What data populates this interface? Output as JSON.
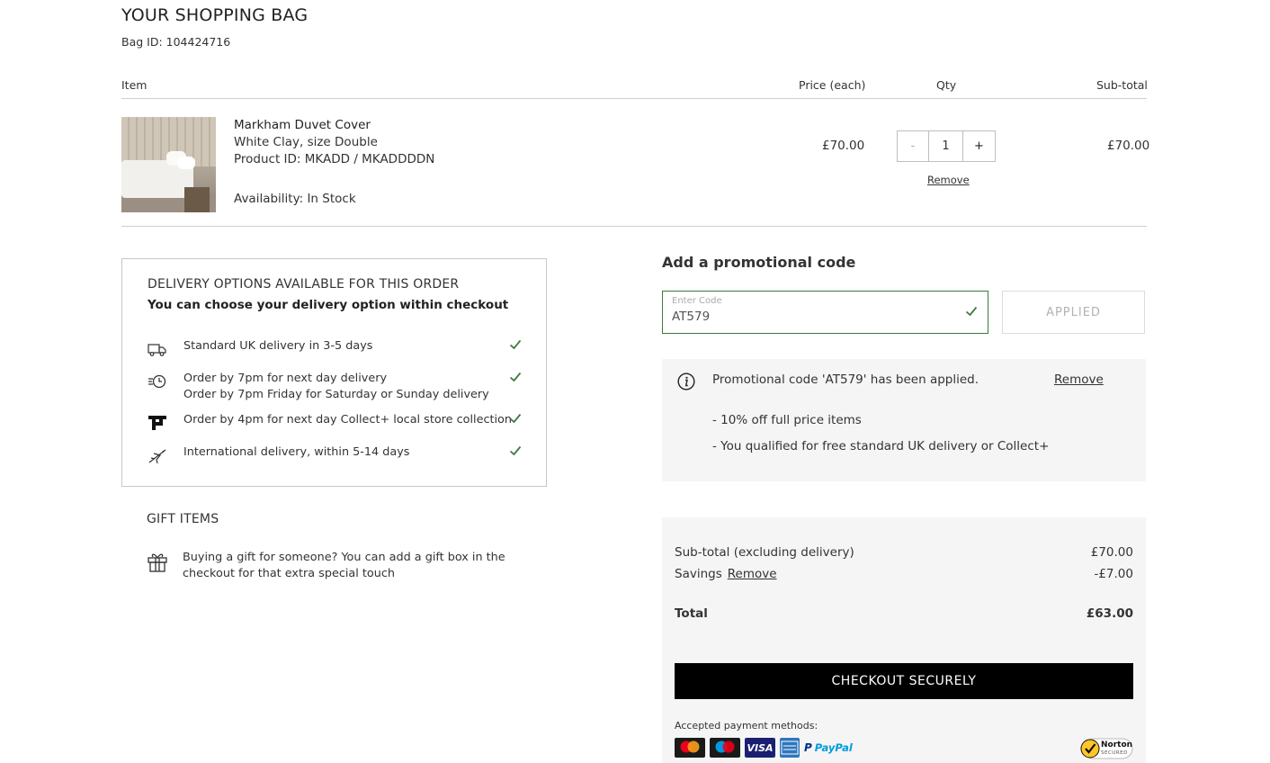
{
  "header": {
    "title": "YOUR SHOPPING BAG",
    "bag_id": "Bag ID: 104424716"
  },
  "columns": {
    "item": "Item",
    "price": "Price (each)",
    "qty": "Qty",
    "subtotal": "Sub-total"
  },
  "item": {
    "name": "Markham Duvet Cover",
    "variant": "White Clay, size Double",
    "product_id": "Product ID: MKADD / MKADDDDN",
    "availability_label": "Availability:",
    "availability_value": "In Stock",
    "price": "£70.00",
    "qty_minus": "-",
    "qty": "1",
    "qty_plus": "+",
    "remove": "Remove",
    "subtotal": "£70.00"
  },
  "delivery": {
    "title": "DELIVERY OPTIONS AVAILABLE FOR THIS ORDER",
    "subtitle": "You can choose your delivery option within checkout",
    "options": [
      {
        "icon": "truck-icon",
        "lines": [
          "Standard UK delivery in 3-5 days"
        ]
      },
      {
        "icon": "next-day-clock-icon",
        "lines": [
          "Order by 7pm for next day delivery",
          "Order by 7pm Friday for Saturday or Sunday delivery"
        ]
      },
      {
        "icon": "collect-plus-icon",
        "lines": [
          "Order by 4pm for next day Collect+ local store collection"
        ]
      },
      {
        "icon": "plane-icon",
        "lines": [
          "International delivery, within 5-14 days"
        ]
      }
    ],
    "check_color": "#3c7a3c"
  },
  "gift": {
    "title": "GIFT ITEMS",
    "text": "Buying a gift for someone? You can add a gift box in the checkout for that extra special touch"
  },
  "promo": {
    "heading": "Add a promotional code",
    "placeholder": "Enter Code",
    "value": "AT579",
    "button": "APPLIED",
    "applied_message": "Promotional code 'AT579' has been applied.",
    "remove": "Remove",
    "benefits": [
      "- 10% off full price items",
      "- You qualified for free standard UK delivery or Collect+"
    ]
  },
  "summary": {
    "subtotal_label": "Sub-total (excluding delivery)",
    "subtotal_value": "£70.00",
    "savings_label": "Savings",
    "savings_remove": "Remove",
    "savings_value": "-£7.00",
    "total_label": "Total",
    "total_value": "£63.00",
    "checkout": "CHECKOUT SECURELY",
    "payment_label": "Accepted payment methods:",
    "payment_methods": [
      "mastercard-icon",
      "maestro-icon",
      "visa-icon",
      "amex-icon",
      "paypal-icon"
    ],
    "visa_text": "VISA",
    "paypal_text": "PayPal",
    "norton_text": "Norton",
    "norton_sub": "SECURED"
  },
  "colors": {
    "accent_green": "#3c7a3c",
    "checkout_bg": "#000000",
    "panel_bg": "#f5f5f5"
  }
}
